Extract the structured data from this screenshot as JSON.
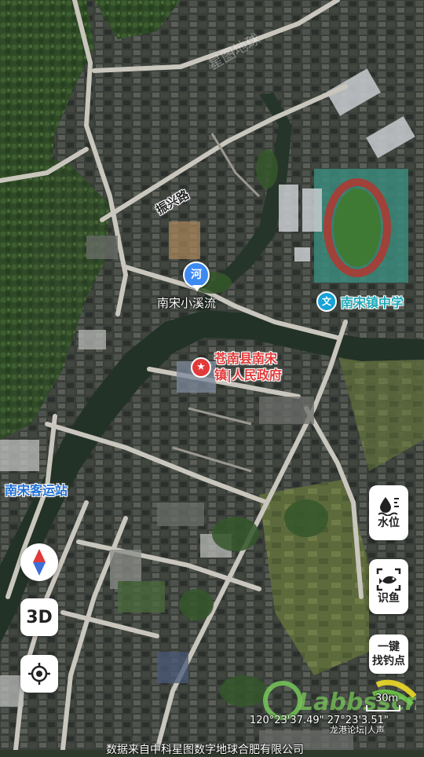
{
  "map": {
    "provider_watermark": "星图地球",
    "labels": {
      "road_zhenxing": "振兴路",
      "river": "南宋小溪流",
      "river_pin": "河",
      "school": "南宋镇中学",
      "school_pin": "文",
      "government": "苍南县南宋镇|人民政府",
      "government_line1": "苍南县南宋",
      "government_line2": "镇|人民政府",
      "bus_station": "南宋客运站"
    }
  },
  "controls": {
    "compass": "compass-icon",
    "view_3d": "3D",
    "locate": "locate-icon"
  },
  "side_buttons": [
    {
      "label": "水位",
      "icon": "water-level-icon"
    },
    {
      "label": "识鱼",
      "icon": "fish-scan-icon"
    },
    {
      "label_line1": "一键",
      "label_line2": "找钓点"
    }
  ],
  "footer": {
    "scale": "30m",
    "coordinates": "120°23'37.49\"  27°23'3.51\"",
    "forum_watermark": "龙港论坛|人声",
    "attribution": "数据来自中科星图数字地球合肥有限公司",
    "logo_text": "Labbsscn"
  },
  "colors": {
    "river_blue": "#1f6fd6",
    "government_red": "#e23a3a",
    "school_cyan": "#17a3d6"
  }
}
